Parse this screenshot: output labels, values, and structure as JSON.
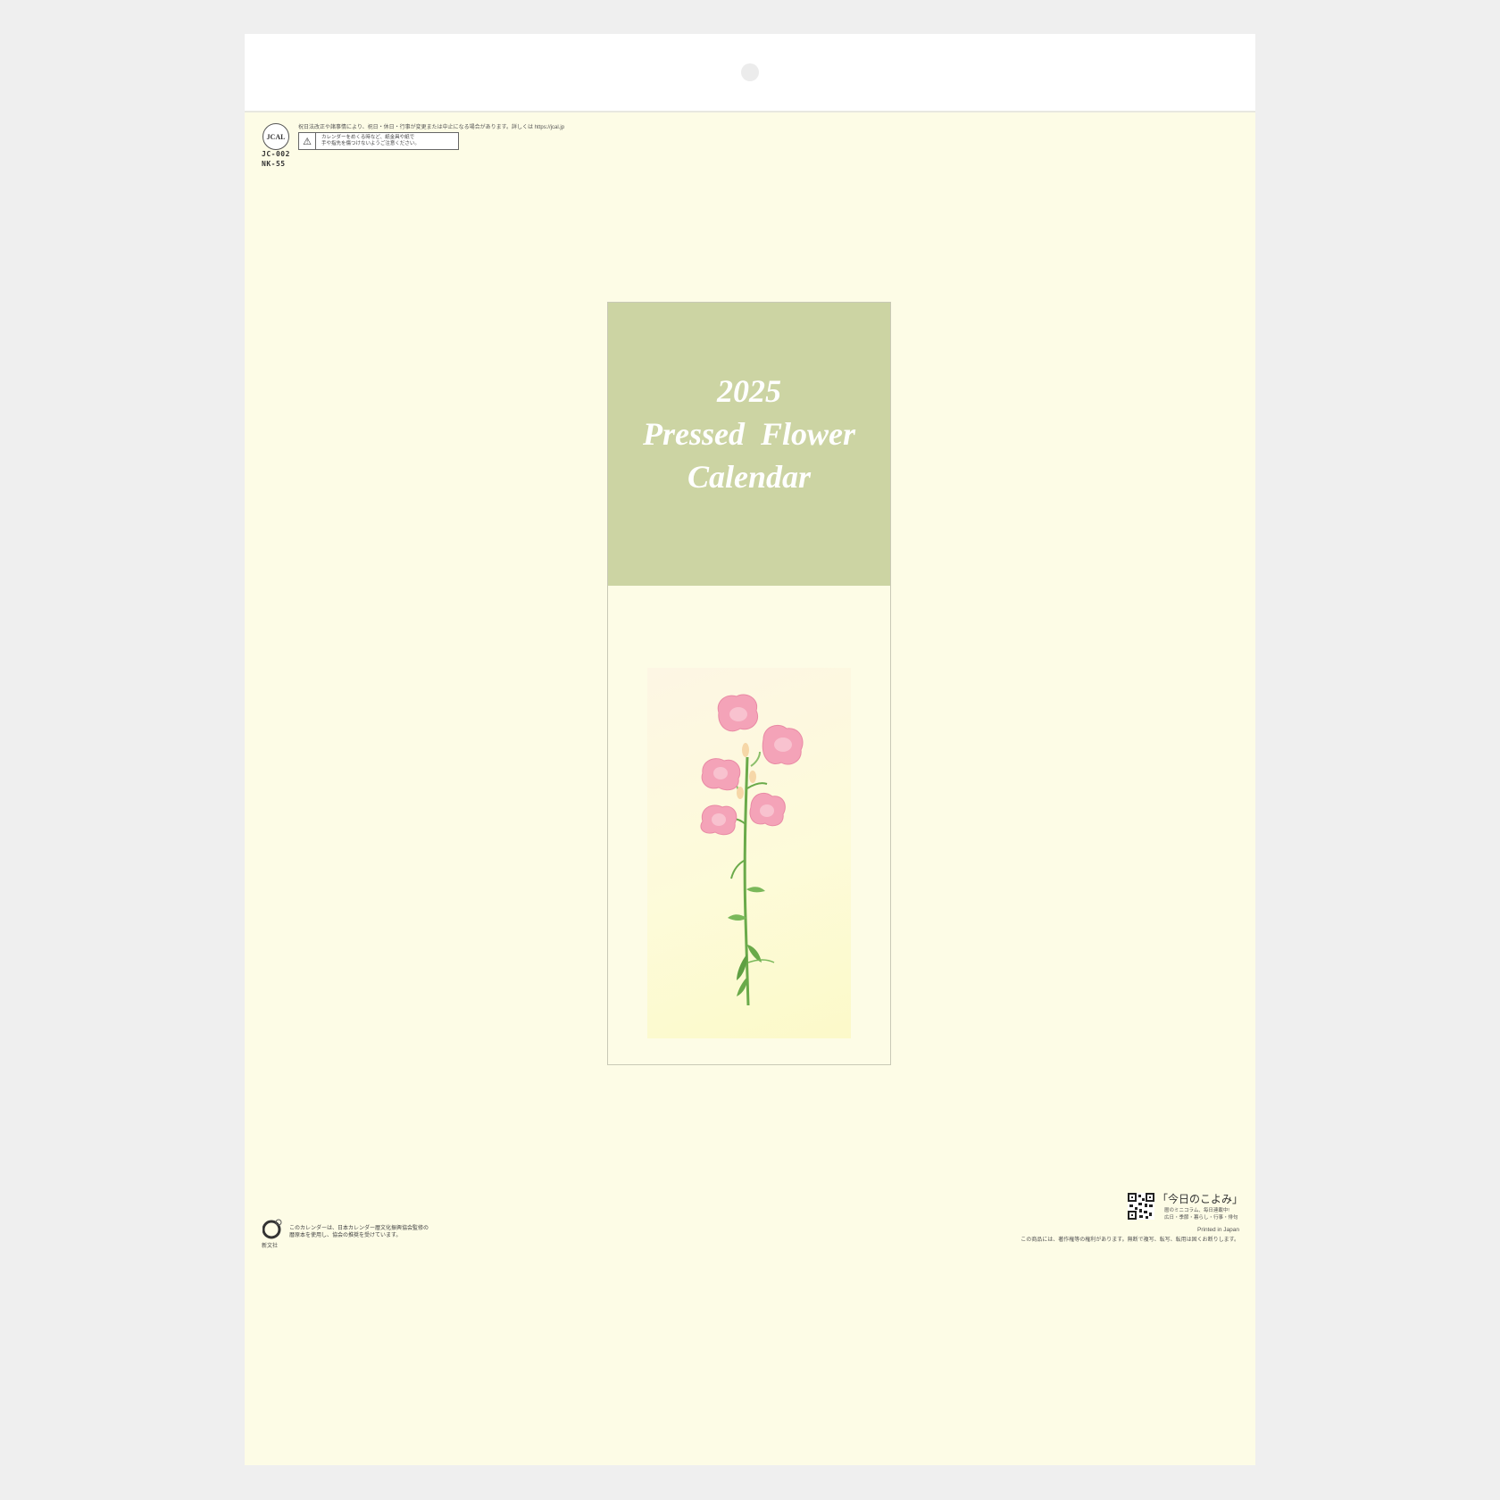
{
  "cover": {
    "year": "2025",
    "title_line1": "Pressed  Flower",
    "title_line2": "Calendar"
  },
  "top_left": {
    "logo_text": "JCAL",
    "code1": "JC-002",
    "code2": "NK-55",
    "notice": "祝日法改正や諸事情により、祝日・休日・行事が変更または中止になる場合があります。詳しくは https://jcal.jp",
    "warning_icon": "warning-triangle-icon",
    "warning_line1": "カレンダーをめくる時など、紙金具や紙で",
    "warning_line2": "手や指先を傷つけないようご注意ください。"
  },
  "bottom_left": {
    "publisher": "新文社",
    "note_line1": "このカレンダーは、日本カレンダー暦文化振興協会監修の",
    "note_line2": "暦原本を使用し、協会の推奨を受けています。"
  },
  "bottom_right": {
    "koyomi_title": "「今日のこよみ」",
    "koyomi_line1": "暦のミニコラム、毎日連載中!",
    "koyomi_line2": "広日・季節・暮らし・行事・俳句",
    "printed": "Printed in Japan",
    "copyright": "この商品には、著作権等の権利があります。無断で複写、転写、転用は固くお断りします。"
  },
  "colors": {
    "sheet": "#fdfce6",
    "header": "#ccd4a3",
    "flower": "#f4a3b8",
    "stem": "#6aaa4a"
  }
}
